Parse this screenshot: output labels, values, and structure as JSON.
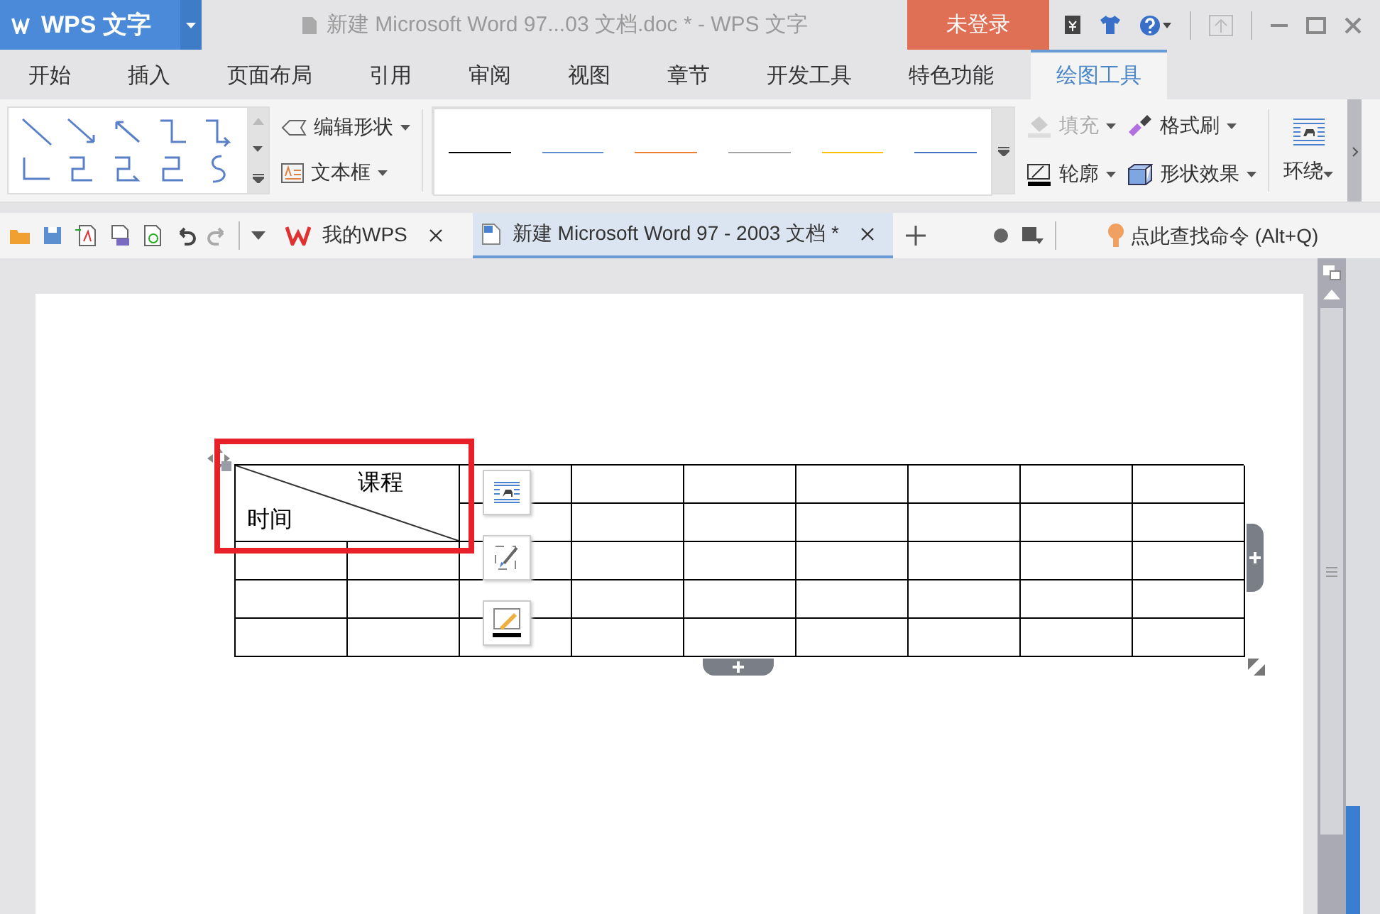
{
  "title_bar": {
    "app_name": "WPS 文字",
    "document_title": "新建 Microsoft Word 97...03 文档.doc * - WPS 文字",
    "login": "未登录"
  },
  "menu_tabs": [
    {
      "label": "开始",
      "selected": false
    },
    {
      "label": "插入",
      "selected": false
    },
    {
      "label": "页面布局",
      "selected": false
    },
    {
      "label": "引用",
      "selected": false
    },
    {
      "label": "审阅",
      "selected": false
    },
    {
      "label": "视图",
      "selected": false
    },
    {
      "label": "章节",
      "selected": false
    },
    {
      "label": "开发工具",
      "selected": false
    },
    {
      "label": "特色功能",
      "selected": false
    },
    {
      "label": "绘图工具",
      "selected": true
    }
  ],
  "ribbon": {
    "edit_shape": "编辑形状",
    "text_box": "文本框",
    "line_styles": [
      {
        "color": "#000000"
      },
      {
        "color": "#5b8fd0"
      },
      {
        "color": "#ed7d31"
      },
      {
        "color": "#a5a5a5"
      },
      {
        "color": "#ffc000"
      },
      {
        "color": "#4472c4"
      }
    ],
    "style_buttons": [
      {
        "label": "填充",
        "disabled": true
      },
      {
        "label": "格式刷",
        "disabled": false
      },
      {
        "label": "轮廓",
        "disabled": false
      },
      {
        "label": "形状效果",
        "disabled": false
      }
    ],
    "wrap": "环绕"
  },
  "doc_tabs": [
    {
      "label": "我的WPS",
      "selected": false
    },
    {
      "label": "新建 Microsoft Word 97 - 2003 文档 *",
      "selected": true
    }
  ],
  "command_search": {
    "placeholder": "点此查找命令 (Alt+Q)"
  },
  "table": {
    "header_cell": {
      "top_label": "课程",
      "bottom_label": "时间"
    }
  }
}
